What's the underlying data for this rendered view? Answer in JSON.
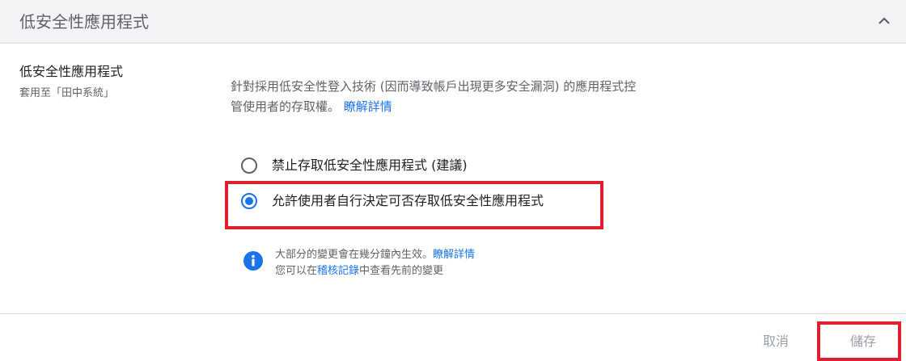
{
  "header": {
    "title": "低安全性應用程式",
    "collapse_icon": "chevron-up-icon"
  },
  "setting": {
    "title": "低安全性應用程式",
    "subtitle": "套用至「田中系統」"
  },
  "description": {
    "text": "針對採用低安全性登入技術 (因而導致帳戶出現更多安全漏洞) 的應用程式控管使用者的存取權。",
    "link": "瞭解詳情"
  },
  "options": [
    {
      "label": "禁止存取低安全性應用程式 (建議)",
      "selected": false
    },
    {
      "label": "允許使用者自行決定可否存取低安全性應用程式",
      "selected": true
    }
  ],
  "info": {
    "icon": "info-icon",
    "line1_text": "大部分的變更會在幾分鐘內生效。",
    "line1_link": "瞭解詳情",
    "line2_pre": "您可以在",
    "line2_link": "稽核記錄",
    "line2_post": "中查看先前的變更"
  },
  "footer": {
    "cancel_label": "取消",
    "save_label": "儲存"
  },
  "colors": {
    "accent": "#1a73e8",
    "highlight": "#e0202f",
    "header_bg": "#f1f3f4"
  }
}
